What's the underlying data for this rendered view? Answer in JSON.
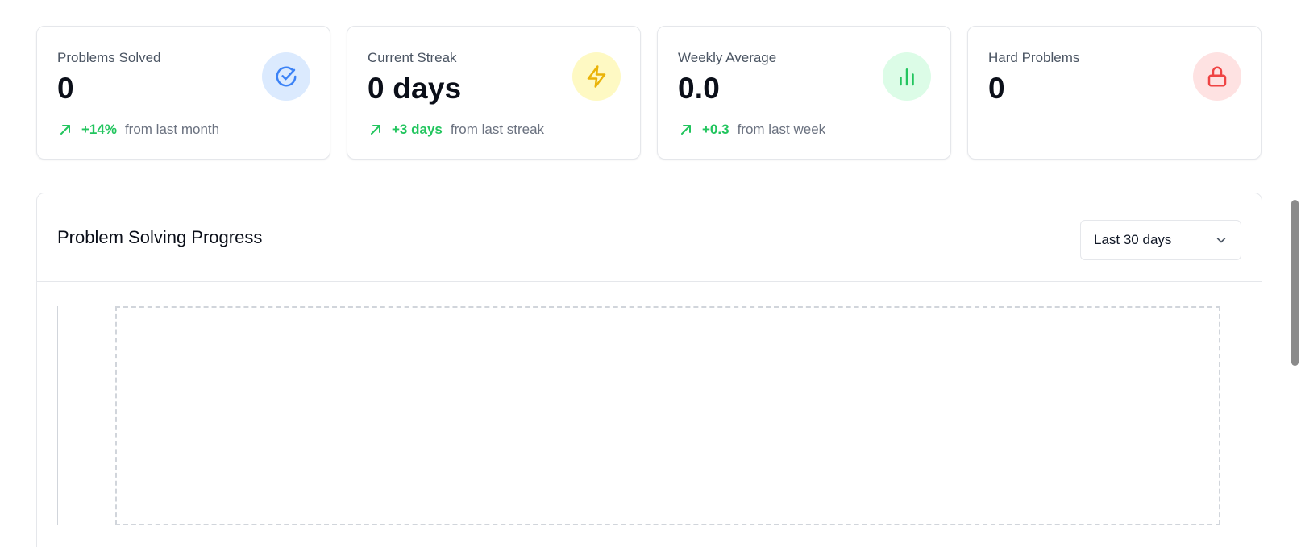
{
  "stats": [
    {
      "title": "Problems Solved",
      "value": "0",
      "trend_delta": "+14%",
      "trend_note": "from last month",
      "icon": "check-circle-icon",
      "icon_color": "#3b82f6",
      "icon_bg": "#dbeafe"
    },
    {
      "title": "Current Streak",
      "value": "0 days",
      "trend_delta": "+3 days",
      "trend_note": "from last streak",
      "icon": "lightning-icon",
      "icon_color": "#eab308",
      "icon_bg": "#fef9c3"
    },
    {
      "title": "Weekly Average",
      "value": "0.0",
      "trend_delta": "+0.3",
      "trend_note": "from last week",
      "icon": "bar-chart-icon",
      "icon_color": "#22c55e",
      "icon_bg": "#dcfce7"
    },
    {
      "title": "Hard Problems",
      "value": "0",
      "icon": "lock-icon",
      "icon_color": "#ef4444",
      "icon_bg": "#fee2e2"
    }
  ],
  "progress": {
    "title": "Problem Solving Progress",
    "range_selected": "Last 30 days"
  },
  "colors": {
    "positive": "#22c55e",
    "muted_text": "#6b7280",
    "border": "#e5e7eb"
  }
}
